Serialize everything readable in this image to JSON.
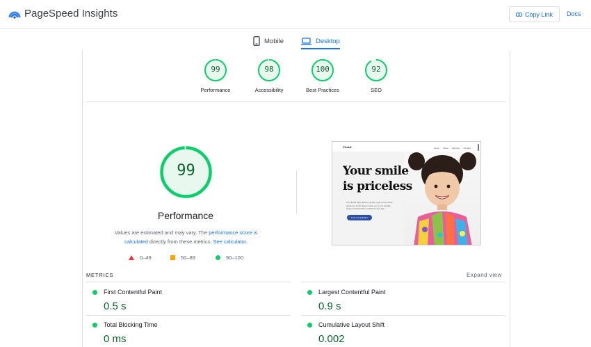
{
  "header": {
    "title": "PageSpeed Insights",
    "copy_link_label": "Copy Link",
    "docs_label": "Docs"
  },
  "tabs": [
    {
      "label": "Mobile",
      "icon": "phone-icon",
      "active": false
    },
    {
      "label": "Desktop",
      "icon": "laptop-icon",
      "active": true
    }
  ],
  "scores": [
    {
      "value": "99",
      "label": "Performance",
      "fraction": 0.99
    },
    {
      "value": "98",
      "label": "Accessibility",
      "fraction": 0.98
    },
    {
      "value": "100",
      "label": "Best Practices",
      "fraction": 1.0
    },
    {
      "value": "92",
      "label": "SEO",
      "fraction": 0.92
    }
  ],
  "performance": {
    "score": "99",
    "fraction": 0.99,
    "title": "Performance",
    "desc_prefix": "Values are estimated and may vary. The ",
    "desc_link1": "performance score is calculated",
    "desc_middle": " directly from these metrics. ",
    "desc_link2": "See calculator",
    "desc_suffix": "."
  },
  "legend": [
    {
      "range": "0–49",
      "shape": "triangle",
      "color": "#e53935"
    },
    {
      "range": "50–89",
      "shape": "square",
      "color": "#ffa400"
    },
    {
      "range": "90–100",
      "shape": "circle",
      "color": "#0cce6b"
    }
  ],
  "screenshot": {
    "logo": "Dental",
    "nav_links": [
      "Home",
      "About",
      "Services",
      "Contact"
    ],
    "headline_1": "Your smile",
    "headline_2": "is priceless",
    "body": "Our dental clinic delivers gentle, expert care using advanced technology to keep your teeth healthy, bright and beautifully confident every day.",
    "button": "Free Consultation"
  },
  "metrics": {
    "title": "METRICS",
    "expand_label": "Expand view",
    "items": [
      {
        "name": "First Contentful Paint",
        "value": "0.5 s"
      },
      {
        "name": "Largest Contentful Paint",
        "value": "0.9 s"
      },
      {
        "name": "Total Blocking Time",
        "value": "0 ms"
      },
      {
        "name": "Cumulative Layout Shift",
        "value": "0.002"
      }
    ]
  },
  "colors": {
    "accent": "#1a73e8",
    "good": "#0cce6b",
    "good_text": "#0d652d",
    "good_fill": "#e8f8ee"
  }
}
